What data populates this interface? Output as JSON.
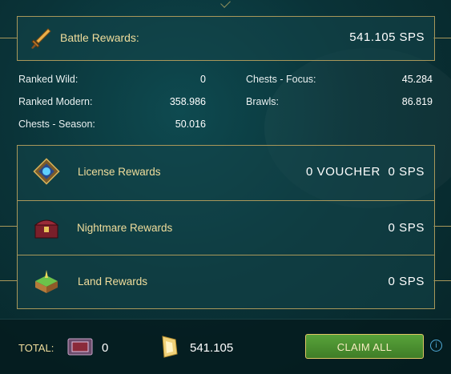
{
  "battle": {
    "label": "Battle Rewards:",
    "amount": "541.105",
    "unit": "SPS"
  },
  "stats": [
    {
      "label": "Ranked Wild:",
      "value": "0"
    },
    {
      "label": "Ranked Modern:",
      "value": "358.986"
    },
    {
      "label": "Chests - Season:",
      "value": "50.016"
    },
    {
      "label": "Chests - Focus:",
      "value": "45.284"
    },
    {
      "label": "Brawls:",
      "value": "86.819"
    }
  ],
  "rewards": [
    {
      "label": "License Rewards",
      "voucher_amount": "0",
      "voucher_unit": "VOUCHER",
      "amount": "0",
      "unit": "SPS",
      "icon": "license-icon"
    },
    {
      "label": "Nightmare Rewards",
      "amount": "0",
      "unit": "SPS",
      "icon": "nightmare-chest-icon"
    },
    {
      "label": "Land Rewards",
      "amount": "0",
      "unit": "SPS",
      "icon": "land-icon"
    }
  ],
  "footer": {
    "total_label": "TOTAL:",
    "voucher_total": "0",
    "sps_total": "541.105",
    "claim_label": "CLAIM ALL",
    "info_glyph": "i"
  },
  "colors": {
    "gold": "#f0dd9c",
    "border": "#a8975a",
    "claim_green": "#4f8f31"
  }
}
